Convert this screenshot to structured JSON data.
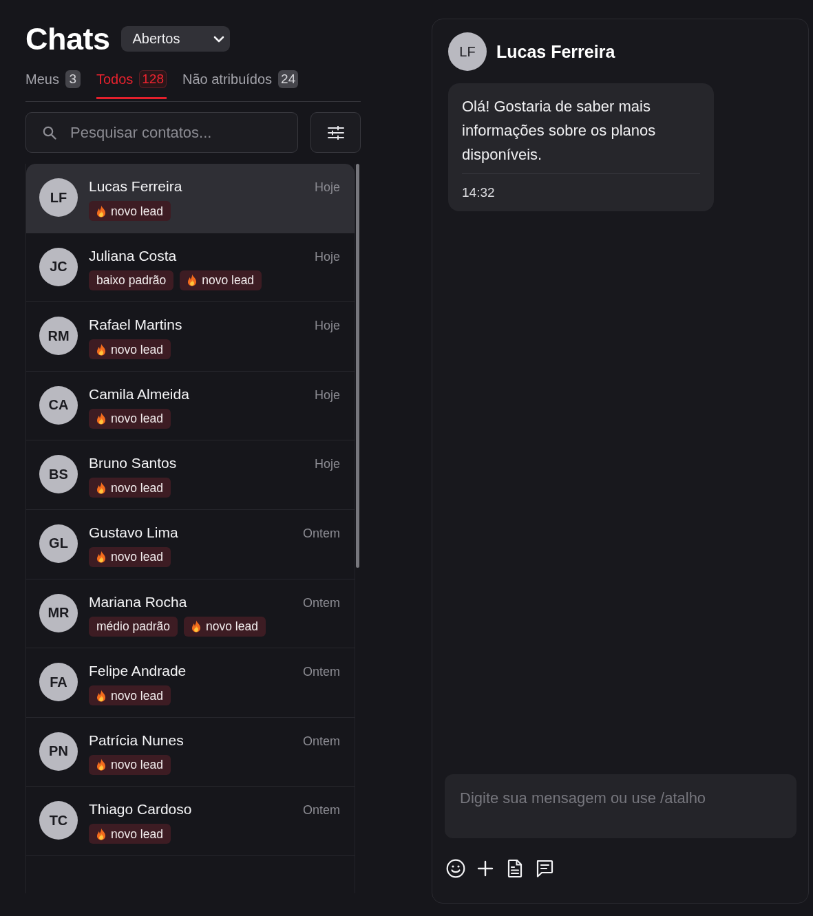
{
  "header": {
    "title": "Chats",
    "status_filter": {
      "value": "Abertos"
    }
  },
  "tabs": [
    {
      "label": "Meus",
      "count": "3",
      "selected": false
    },
    {
      "label": "Todos",
      "count": "128",
      "selected": true
    },
    {
      "label": "Não atribuídos",
      "count": "24",
      "selected": false
    }
  ],
  "search": {
    "placeholder": "Pesquisar contatos..."
  },
  "conversations": [
    {
      "initials": "LF",
      "name": "Lucas Ferreira",
      "time": "Hoje",
      "selected": true,
      "tags": [
        {
          "kind": "flame",
          "label": "novo lead"
        }
      ]
    },
    {
      "initials": "JC",
      "name": "Juliana Costa",
      "time": "Hoje",
      "selected": false,
      "tags": [
        {
          "kind": "plain",
          "label": "baixo padrão"
        },
        {
          "kind": "flame",
          "label": "novo lead"
        }
      ]
    },
    {
      "initials": "RM",
      "name": "Rafael Martins",
      "time": "Hoje",
      "selected": false,
      "tags": [
        {
          "kind": "flame",
          "label": "novo lead"
        }
      ]
    },
    {
      "initials": "CA",
      "name": "Camila Almeida",
      "time": "Hoje",
      "selected": false,
      "tags": [
        {
          "kind": "flame",
          "label": "novo lead"
        }
      ]
    },
    {
      "initials": "BS",
      "name": "Bruno Santos",
      "time": "Hoje",
      "selected": false,
      "tags": [
        {
          "kind": "flame",
          "label": "novo lead"
        }
      ]
    },
    {
      "initials": "GL",
      "name": "Gustavo Lima",
      "time": "Ontem",
      "selected": false,
      "tags": [
        {
          "kind": "flame",
          "label": "novo lead"
        }
      ]
    },
    {
      "initials": "MR",
      "name": "Mariana Rocha",
      "time": "Ontem",
      "selected": false,
      "tags": [
        {
          "kind": "plain",
          "label": "médio padrão"
        },
        {
          "kind": "flame",
          "label": "novo lead"
        }
      ]
    },
    {
      "initials": "FA",
      "name": "Felipe Andrade",
      "time": "Ontem",
      "selected": false,
      "tags": [
        {
          "kind": "flame",
          "label": "novo lead"
        }
      ]
    },
    {
      "initials": "PN",
      "name": "Patrícia Nunes",
      "time": "Ontem",
      "selected": false,
      "tags": [
        {
          "kind": "flame",
          "label": "novo lead"
        }
      ]
    },
    {
      "initials": "TC",
      "name": "Thiago Cardoso",
      "time": "Ontem",
      "selected": false,
      "tags": [
        {
          "kind": "flame",
          "label": "novo lead"
        }
      ]
    }
  ],
  "chat": {
    "contact": {
      "initials": "LF",
      "name": "Lucas Ferreira"
    },
    "messages": [
      {
        "text": "Olá! Gostaria de saber mais informações sobre os planos disponíveis.",
        "time": "14:32"
      }
    ],
    "composer": {
      "placeholder": "Digite sua mensagem ou use /atalho"
    }
  }
}
